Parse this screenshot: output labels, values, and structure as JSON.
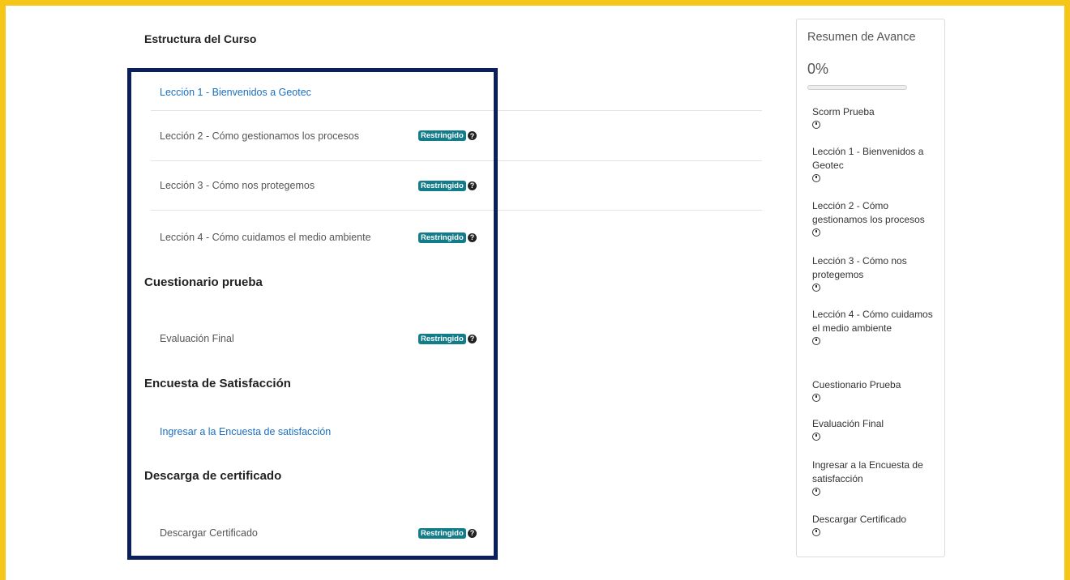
{
  "course": {
    "title": "Estructura del Curso",
    "lessons": [
      {
        "label": "Lección 1 - Bienvenidos a Geotec",
        "link": true
      },
      {
        "label": "Lección 2 - Cómo gestionamos los procesos",
        "badge": "Restringido"
      },
      {
        "label": "Lección 3 - Cómo nos protegemos",
        "badge": "Restringido"
      },
      {
        "label": "Lección 4 - Cómo cuidamos el medio ambiente",
        "badge": "Restringido"
      }
    ]
  },
  "quiz": {
    "title": "Cuestionario prueba",
    "item": {
      "label": "Evaluación Final",
      "badge": "Restringido"
    }
  },
  "survey": {
    "title": "Encuesta de Satisfacción",
    "item": {
      "label": "Ingresar a la Encuesta de satisfacción"
    }
  },
  "certificate": {
    "title": "Descarga de certificado",
    "item": {
      "label": "Descargar Certificado",
      "badge": "Restringido"
    }
  },
  "sidebar": {
    "title": "Resumen de Avance",
    "percent_label": "0%",
    "progress": 0,
    "items": [
      "Scorm Prueba",
      "Lección 1 - Bienvenidos a Geotec",
      "Lección 2 - Cómo gestionamos los procesos",
      "Lección 3 - Cómo nos protegemos",
      "Lección 4 - Cómo cuidamos el medio ambiente",
      "Cuestionario Prueba",
      "Evaluación Final",
      "Ingresar a la Encuesta de satisfacción",
      "Descargar Certificado"
    ]
  },
  "icons": {
    "restricted_help": "question-circle-icon",
    "status": "clock-icon"
  },
  "colors": {
    "accent": "#127c8a",
    "link": "#1a6fbf",
    "highlight_border": "#0a1f5c",
    "background": "#f5c518"
  }
}
